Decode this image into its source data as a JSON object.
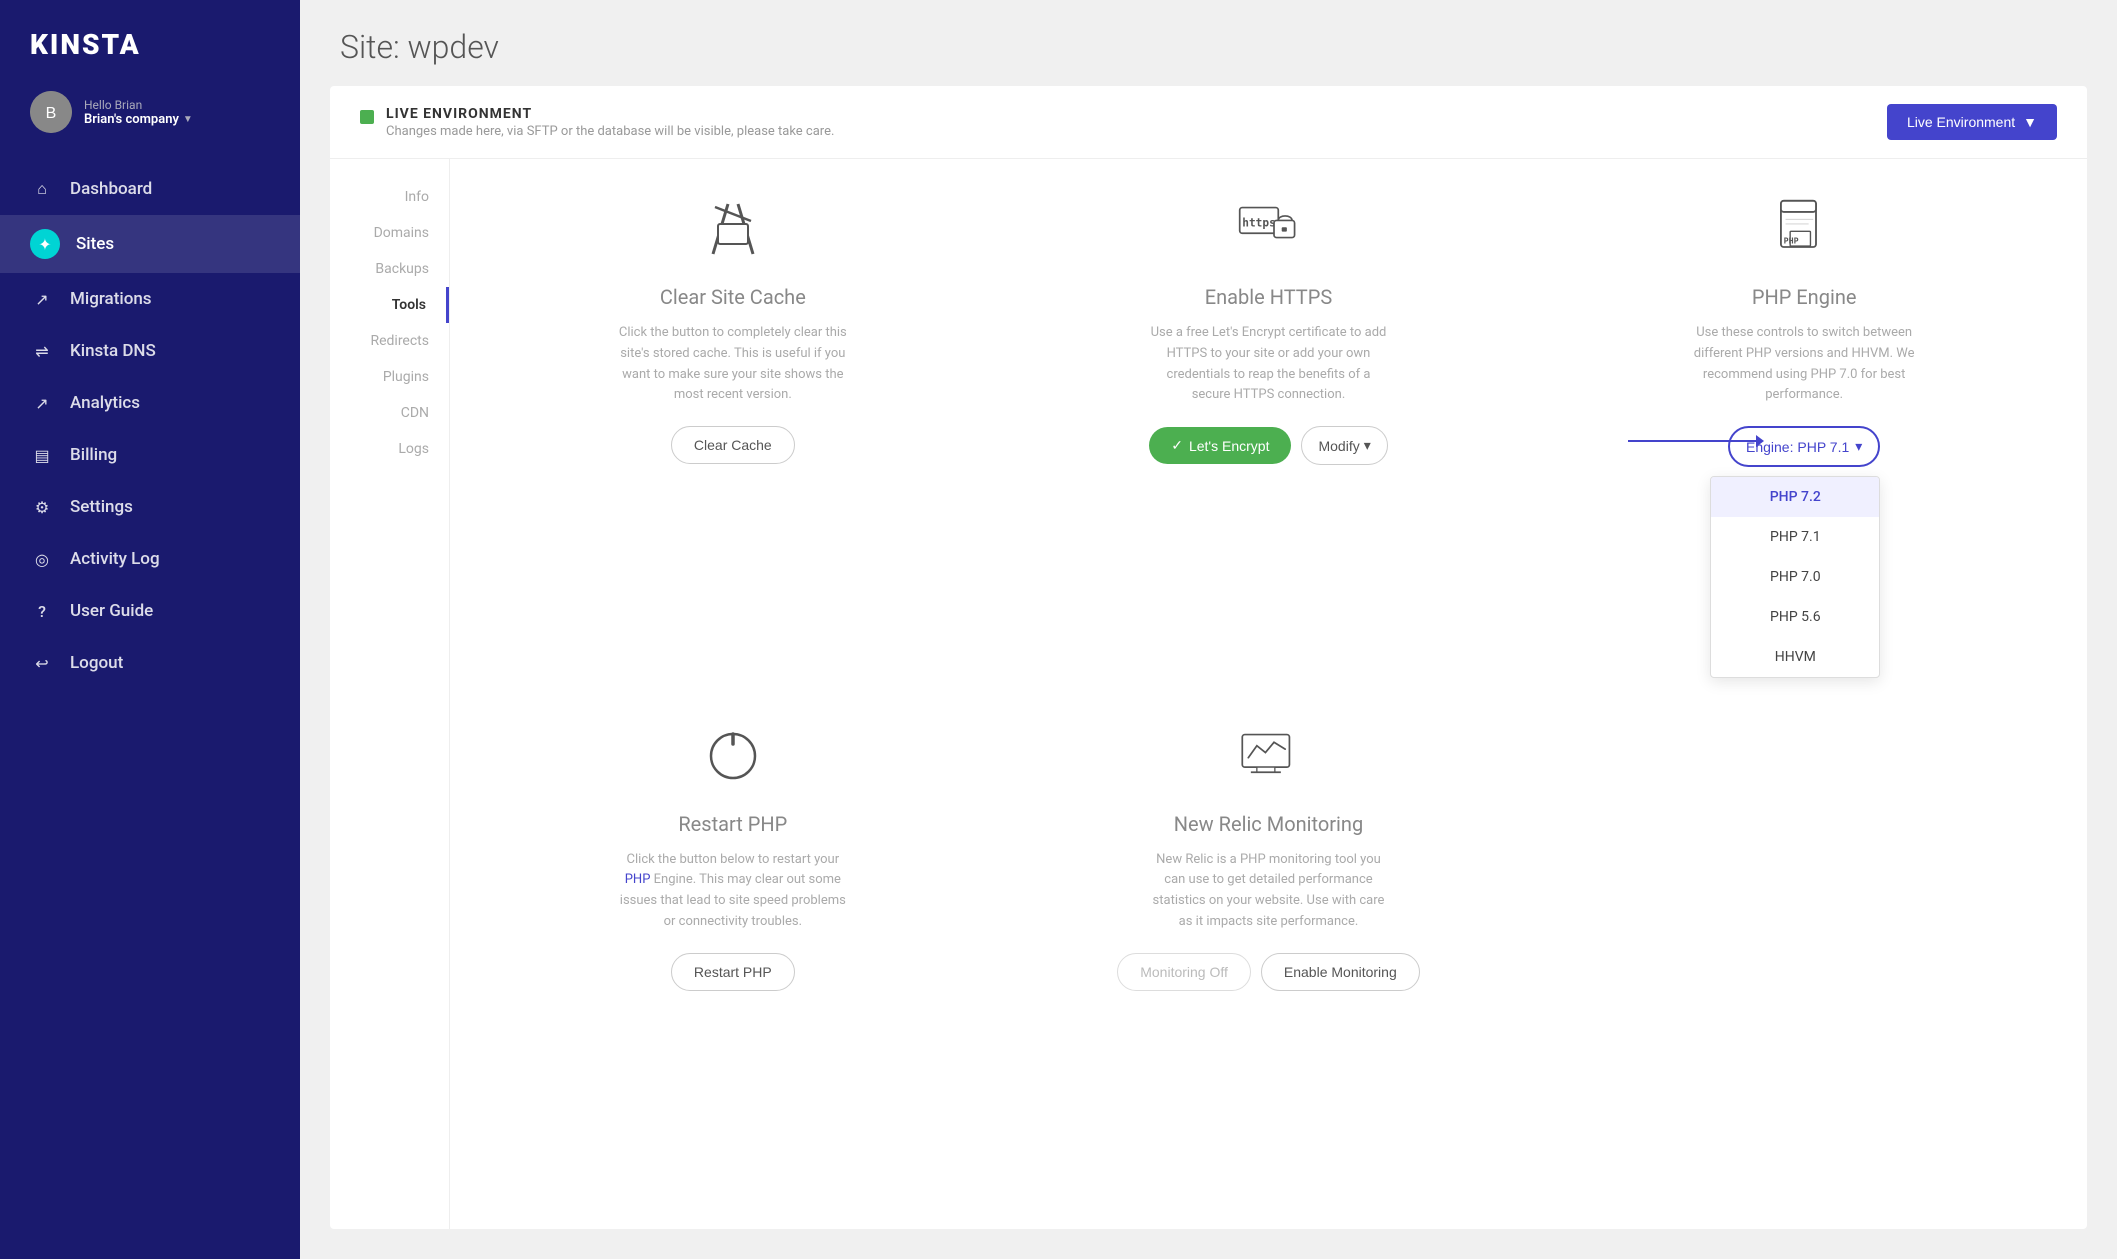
{
  "sidebar": {
    "logo": "KINSTA",
    "user": {
      "hello": "Hello Brian",
      "company": "Brian's company",
      "avatar_initial": "B"
    },
    "nav_items": [
      {
        "id": "dashboard",
        "label": "Dashboard",
        "icon": "home"
      },
      {
        "id": "sites",
        "label": "Sites",
        "icon": "sites",
        "active": true
      },
      {
        "id": "migrations",
        "label": "Migrations",
        "icon": "arrow"
      },
      {
        "id": "kinsta-dns",
        "label": "Kinsta DNS",
        "icon": "dns"
      },
      {
        "id": "analytics",
        "label": "Analytics",
        "icon": "chart"
      },
      {
        "id": "billing",
        "label": "Billing",
        "icon": "billing"
      },
      {
        "id": "settings",
        "label": "Settings",
        "icon": "settings"
      },
      {
        "id": "activity-log",
        "label": "Activity Log",
        "icon": "eye"
      },
      {
        "id": "user-guide",
        "label": "User Guide",
        "icon": "guide"
      },
      {
        "id": "logout",
        "label": "Logout",
        "icon": "logout"
      }
    ]
  },
  "header": {
    "title": "Site:",
    "site_name": "wpdev"
  },
  "environment": {
    "badge_label": "LIVE ENVIRONMENT",
    "subtitle": "Changes made here, via SFTP or the database will be visible, please take care.",
    "dropdown_label": "Live Environment"
  },
  "sub_nav": {
    "items": [
      {
        "id": "info",
        "label": "Info"
      },
      {
        "id": "domains",
        "label": "Domains"
      },
      {
        "id": "backups",
        "label": "Backups"
      },
      {
        "id": "tools",
        "label": "Tools",
        "active": true
      },
      {
        "id": "redirects",
        "label": "Redirects"
      },
      {
        "id": "plugins",
        "label": "Plugins"
      },
      {
        "id": "cdn",
        "label": "CDN"
      },
      {
        "id": "logs",
        "label": "Logs"
      }
    ]
  },
  "tools": {
    "clear_cache": {
      "title": "Clear Site Cache",
      "description": "Click the button to completely clear this site's stored cache. This is useful if you want to make sure your site shows the most recent version.",
      "button_label": "Clear Cache"
    },
    "https": {
      "title": "Enable HTTPS",
      "description": "Use a free Let's Encrypt certificate to add HTTPS to your site or add your own credentials to reap the benefits of a secure HTTPS connection.",
      "encrypt_label": "Let's Encrypt",
      "modify_label": "Modify"
    },
    "php": {
      "title": "PHP Engine",
      "description": "Use these controls to switch between different PHP versions and HHVM. We recommend using PHP 7.0 for best performance.",
      "engine_label": "Engine: PHP 7.1",
      "options": [
        "PHP 7.2",
        "PHP 7.1",
        "PHP 7.0",
        "PHP 5.6",
        "HHVM"
      ],
      "selected": "PHP 7.2"
    },
    "restart_php": {
      "title": "Restart PHP",
      "description": "Click the button below to restart your PHP Engine. This may clear out some issues that lead to site speed problems or connectivity troubles.",
      "button_label": "Restart PHP"
    },
    "monitoring": {
      "title": "New Relic Monitoring",
      "description": "New Relic is a PHP monitoring tool you can use to get detailed performance statistics on your website. Use with care as it impacts site performance.",
      "off_label": "Monitoring Off",
      "enable_label": "Enable Monitoring"
    }
  }
}
